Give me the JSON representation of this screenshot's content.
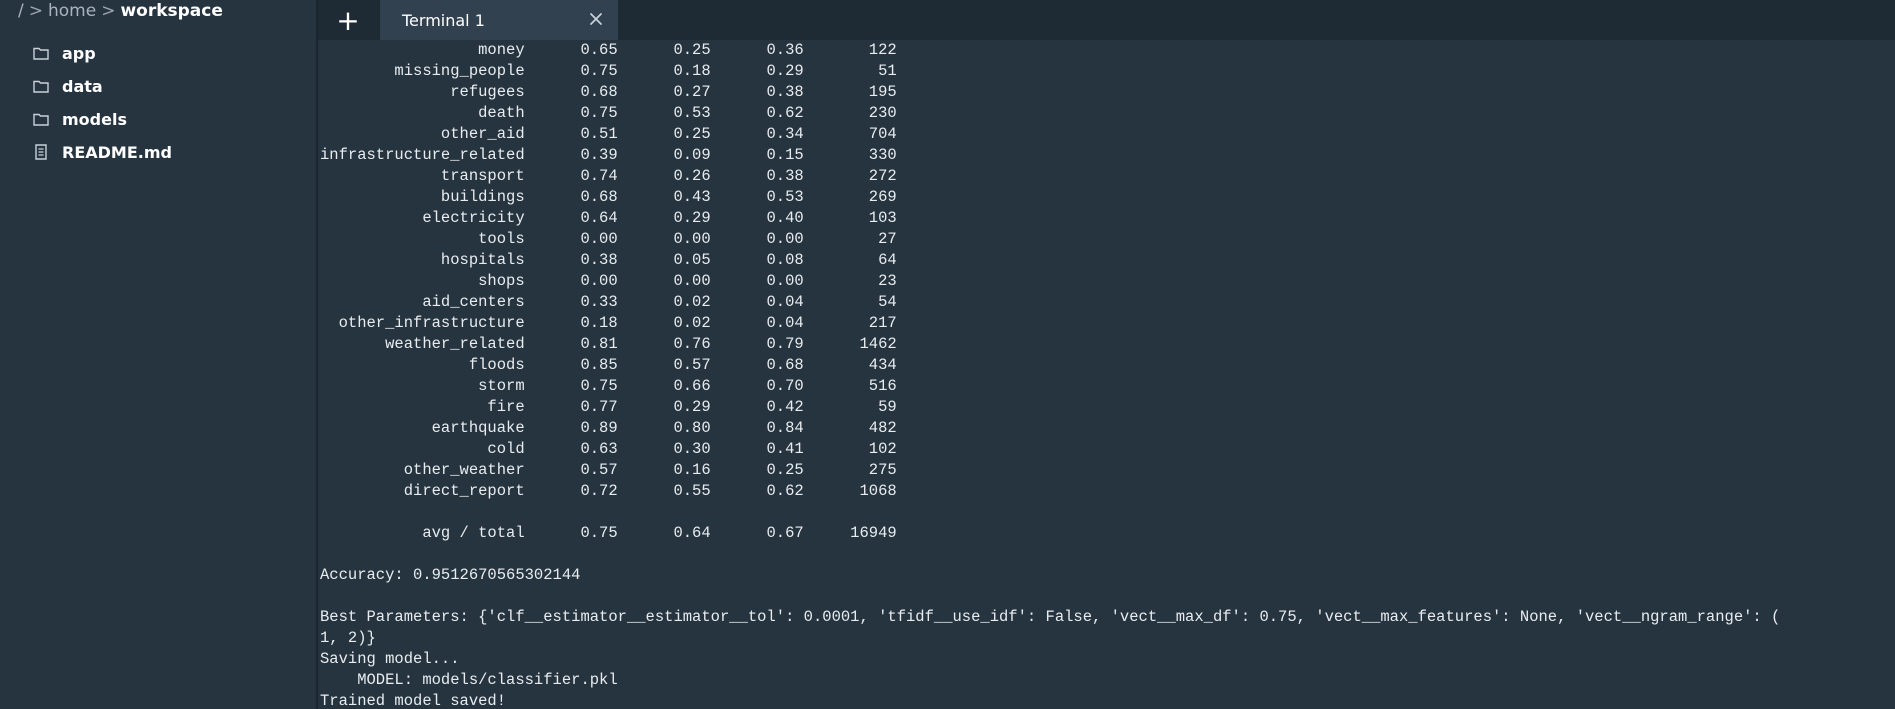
{
  "sidebar": {
    "breadcrumb": [
      {
        "label": "/",
        "current": false
      },
      {
        "label": "home",
        "current": false
      },
      {
        "label": "workspace",
        "current": true
      }
    ],
    "items": [
      {
        "label": "app",
        "icon": "folder-icon"
      },
      {
        "label": "data",
        "icon": "folder-icon"
      },
      {
        "label": "models",
        "icon": "folder-icon"
      },
      {
        "label": "README.md",
        "icon": "file-icon"
      }
    ]
  },
  "tabs": {
    "new_tab_label": "+",
    "active_tab_label": "Terminal 1"
  },
  "terminal": {
    "metrics_rows": [
      {
        "label": "money",
        "precision": "0.65",
        "recall": "0.25",
        "f1": "0.36",
        "support": "122"
      },
      {
        "label": "missing_people",
        "precision": "0.75",
        "recall": "0.18",
        "f1": "0.29",
        "support": "51"
      },
      {
        "label": "refugees",
        "precision": "0.68",
        "recall": "0.27",
        "f1": "0.38",
        "support": "195"
      },
      {
        "label": "death",
        "precision": "0.75",
        "recall": "0.53",
        "f1": "0.62",
        "support": "230"
      },
      {
        "label": "other_aid",
        "precision": "0.51",
        "recall": "0.25",
        "f1": "0.34",
        "support": "704"
      },
      {
        "label": "infrastructure_related",
        "precision": "0.39",
        "recall": "0.09",
        "f1": "0.15",
        "support": "330"
      },
      {
        "label": "transport",
        "precision": "0.74",
        "recall": "0.26",
        "f1": "0.38",
        "support": "272"
      },
      {
        "label": "buildings",
        "precision": "0.68",
        "recall": "0.43",
        "f1": "0.53",
        "support": "269"
      },
      {
        "label": "electricity",
        "precision": "0.64",
        "recall": "0.29",
        "f1": "0.40",
        "support": "103"
      },
      {
        "label": "tools",
        "precision": "0.00",
        "recall": "0.00",
        "f1": "0.00",
        "support": "27"
      },
      {
        "label": "hospitals",
        "precision": "0.38",
        "recall": "0.05",
        "f1": "0.08",
        "support": "64"
      },
      {
        "label": "shops",
        "precision": "0.00",
        "recall": "0.00",
        "f1": "0.00",
        "support": "23"
      },
      {
        "label": "aid_centers",
        "precision": "0.33",
        "recall": "0.02",
        "f1": "0.04",
        "support": "54"
      },
      {
        "label": "other_infrastructure",
        "precision": "0.18",
        "recall": "0.02",
        "f1": "0.04",
        "support": "217"
      },
      {
        "label": "weather_related",
        "precision": "0.81",
        "recall": "0.76",
        "f1": "0.79",
        "support": "1462"
      },
      {
        "label": "floods",
        "precision": "0.85",
        "recall": "0.57",
        "f1": "0.68",
        "support": "434"
      },
      {
        "label": "storm",
        "precision": "0.75",
        "recall": "0.66",
        "f1": "0.70",
        "support": "516"
      },
      {
        "label": "fire",
        "precision": "0.77",
        "recall": "0.29",
        "f1": "0.42",
        "support": "59"
      },
      {
        "label": "earthquake",
        "precision": "0.89",
        "recall": "0.80",
        "f1": "0.84",
        "support": "482"
      },
      {
        "label": "cold",
        "precision": "0.63",
        "recall": "0.30",
        "f1": "0.41",
        "support": "102"
      },
      {
        "label": "other_weather",
        "precision": "0.57",
        "recall": "0.16",
        "f1": "0.25",
        "support": "275"
      },
      {
        "label": "direct_report",
        "precision": "0.72",
        "recall": "0.55",
        "f1": "0.62",
        "support": "1068"
      }
    ],
    "avg_row": {
      "label": "avg / total",
      "precision": "0.75",
      "recall": "0.64",
      "f1": "0.67",
      "support": "16949"
    },
    "accuracy_line": "Accuracy: 0.9512670565302144",
    "best_params_line_1": "Best Parameters: {'clf__estimator__estimator__tol': 0.0001, 'tfidf__use_idf': False, 'vect__max_df': 0.75, 'vect__max_features': None, 'vect__ngram_range': (",
    "best_params_line_2": "1, 2)}",
    "saving_line": "Saving model...",
    "model_line": "    MODEL: models/classifier.pkl",
    "saved_line": "Trained model saved!"
  },
  "colors": {
    "background": "#263440",
    "tabbar": "#1e2a34",
    "active_tab": "#31414f",
    "text": "#e8ecef"
  }
}
